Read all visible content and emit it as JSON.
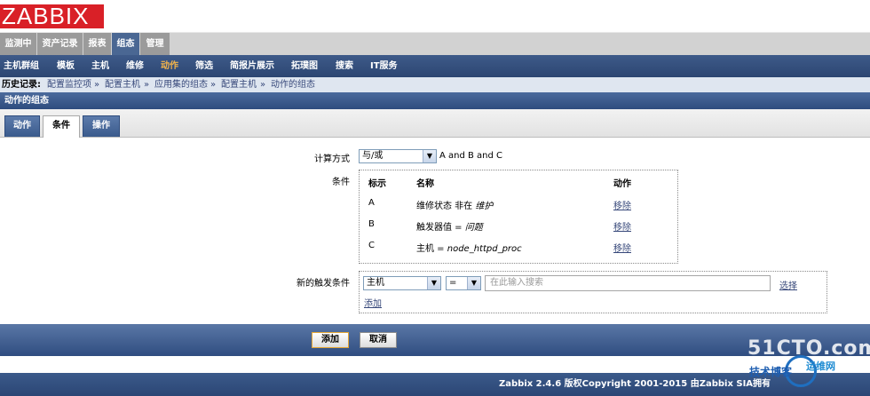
{
  "brand": {
    "logo_text": "ZABBIX",
    "color": "#d92027"
  },
  "top_menu": [
    "监测中",
    "资产记录",
    "报表",
    "组态",
    "管理"
  ],
  "top_menu_active": "组态",
  "sub_menu": [
    "主机群组",
    "模板",
    "主机",
    "维修",
    "动作",
    "筛选",
    "简报片展示",
    "拓璞图",
    "搜索",
    "IT服务"
  ],
  "sub_menu_active": "动作",
  "history": {
    "label": "历史记录:",
    "items": [
      "配置监控项",
      "配置主机",
      "应用集的组态",
      "配置主机",
      "动作的组态"
    ],
    "separator": "»"
  },
  "page_title": "动作的组态",
  "tabs": [
    "动作",
    "条件",
    "操作"
  ],
  "active_tab": "条件",
  "form": {
    "calc_label": "计算方式",
    "calc_value": "与/或",
    "calc_formula": "A and B and C",
    "conditions_label": "条件",
    "conditions_headers": [
      "标示",
      "名称",
      "动作"
    ],
    "conditions": [
      {
        "label": "A",
        "name_plain": "维修状态 非在",
        "name_italic": "维护",
        "action": "移除"
      },
      {
        "label": "B",
        "name_plain": "触发器值 =",
        "name_italic": "问题",
        "action": "移除"
      },
      {
        "label": "C",
        "name_plain": "主机 =",
        "name_italic": "node_httpd_proc",
        "action": "移除"
      }
    ],
    "new_condition_label": "新的触发条件",
    "new_condition_type": "主机",
    "new_condition_operator": "=",
    "search_placeholder": "在此输入搜索",
    "select_link": "选择",
    "add_link": "添加"
  },
  "buttons": {
    "add": "添加",
    "cancel": "取消"
  },
  "footer_text": "Zabbix 2.4.6 版权Copyright 2001-2015 由Zabbix SIA拥有",
  "watermark": {
    "line1": "51CTO.com",
    "line2": "技术博客",
    "line3": "运维网"
  }
}
